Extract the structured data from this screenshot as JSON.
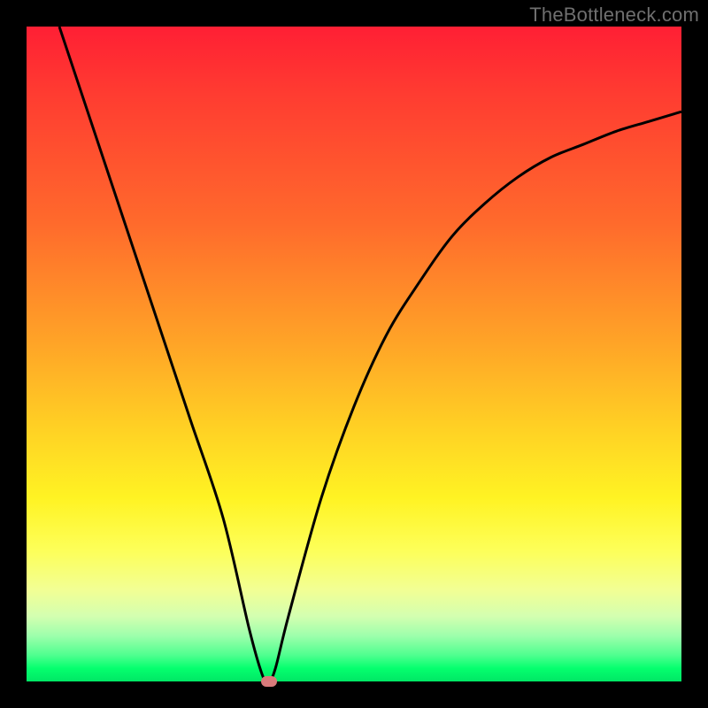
{
  "attribution": "TheBottleneck.com",
  "colors": {
    "frame": "#000000",
    "curve": "#000000",
    "marker": "#d87b7b"
  },
  "chart_data": {
    "type": "line",
    "title": "",
    "xlabel": "",
    "ylabel": "",
    "xlim": [
      0,
      100
    ],
    "ylim": [
      0,
      100
    ],
    "grid": false,
    "legend": false,
    "background_gradient": {
      "stops": [
        {
          "pos": 0,
          "color": "#ff1f34"
        },
        {
          "pos": 30,
          "color": "#ff6a2c"
        },
        {
          "pos": 60,
          "color": "#ffd324"
        },
        {
          "pos": 80,
          "color": "#fdff59"
        },
        {
          "pos": 95,
          "color": "#4fff8f"
        },
        {
          "pos": 100,
          "color": "#00e765"
        }
      ]
    },
    "series": [
      {
        "name": "bottleneck-curve",
        "x": [
          5,
          10,
          15,
          20,
          25,
          30,
          34,
          36,
          37,
          38,
          40,
          45,
          50,
          55,
          60,
          65,
          70,
          75,
          80,
          85,
          90,
          95,
          100
        ],
        "y": [
          100,
          85,
          70,
          55,
          40,
          25,
          8,
          1,
          0,
          2,
          10,
          28,
          42,
          53,
          61,
          68,
          73,
          77,
          80,
          82,
          84,
          85.5,
          87
        ]
      }
    ],
    "markers": [
      {
        "name": "optimal-point",
        "x": 37,
        "y": 0
      }
    ]
  }
}
